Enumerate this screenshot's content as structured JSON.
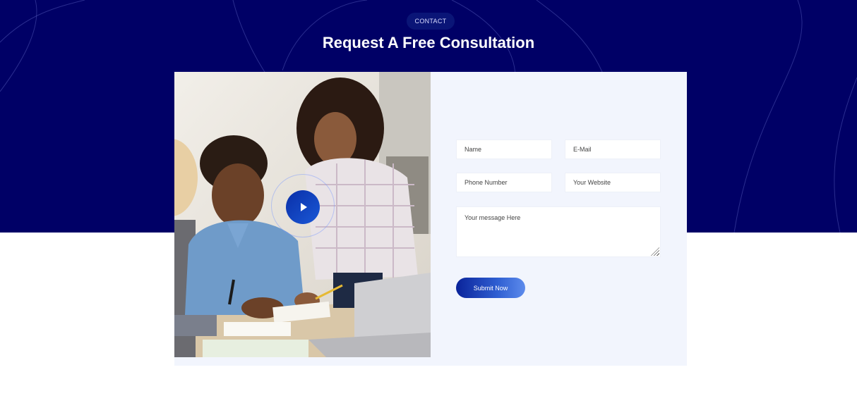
{
  "section": {
    "tag": "CONTACT",
    "title": "Request A Free Consultation"
  },
  "form": {
    "name_placeholder": "Name",
    "email_placeholder": "E-Mail",
    "phone_placeholder": "Phone Number",
    "website_placeholder": "Your Website",
    "message_placeholder": "Your message Here",
    "submit_label": "Submit Now"
  },
  "media": {
    "play_icon": "play-icon"
  },
  "colors": {
    "hero_bg": "#000066",
    "card_bg": "#f2f5fd",
    "accent": "#0a239a"
  }
}
